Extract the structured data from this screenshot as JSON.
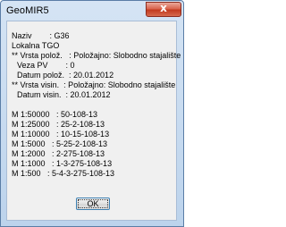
{
  "window": {
    "title": "GeoMIR5",
    "close_glyph": "x"
  },
  "info": {
    "naziv": "Naziv        : G36",
    "lokalna": "Lokalna TGO",
    "vrsta_poloz": "** Vrsta polož.   : Položajno: Slobodno stajalište",
    "veza_pv": "Veza PV        : 0",
    "datum_poloz": "Datum polož.  : 20.01.2012",
    "vrsta_visin": "** Vrsta visin.  : Položajno: Slobodno stajalište",
    "datum_visin": "Datum visin.  : 20.01.2012"
  },
  "scales": [
    "M 1:50000   : 50-108-13",
    "M 1:25000   : 25-2-108-13",
    "M 1:10000   : 10-15-108-13",
    "M 1:5000   : 5-25-2-108-13",
    "M 1:2000   : 2-275-108-13",
    "M 1:1000   : 1-3-275-108-13",
    "M 1:500   : 5-4-3-275-108-13"
  ],
  "buttons": {
    "ok_label": "OK"
  }
}
